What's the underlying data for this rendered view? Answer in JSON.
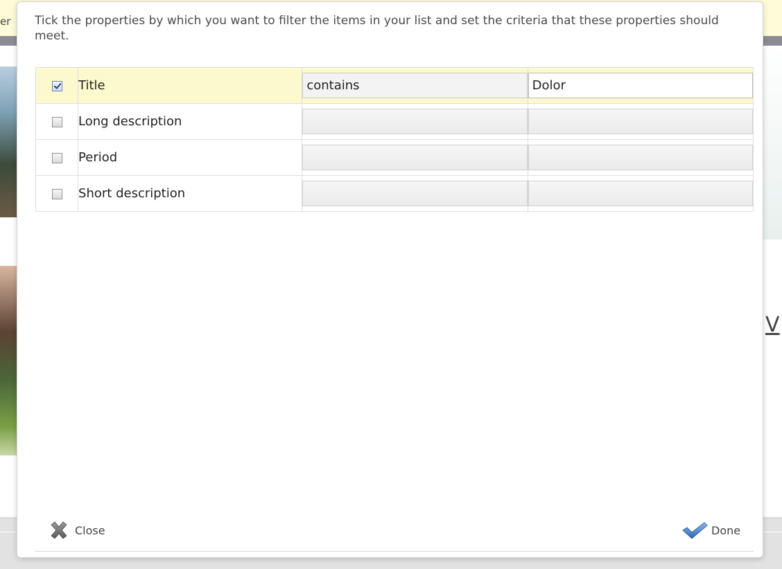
{
  "background": {
    "topbar_fragment": "er",
    "right_letter": "V"
  },
  "dialog": {
    "instructions": "Tick the properties by which you want to filter the items in your list and set the criteria that these properties should meet.",
    "filters": [
      {
        "property": "Title",
        "checked": true,
        "operator": "contains",
        "value": "Dolor"
      },
      {
        "property": "Long description",
        "checked": false,
        "operator": "",
        "value": ""
      },
      {
        "property": "Period",
        "checked": false,
        "operator": "",
        "value": ""
      },
      {
        "property": "Short description",
        "checked": false,
        "operator": "",
        "value": ""
      }
    ],
    "close_label": "Close",
    "done_label": "Done"
  },
  "colors": {
    "active_row": "#fdf9cf",
    "topbar": "#fdfbd8",
    "done_icon": "#3a78c8",
    "close_icon": "#6e6e6e"
  },
  "icons": {
    "close": "close-x-icon",
    "done": "checkmark-icon"
  }
}
